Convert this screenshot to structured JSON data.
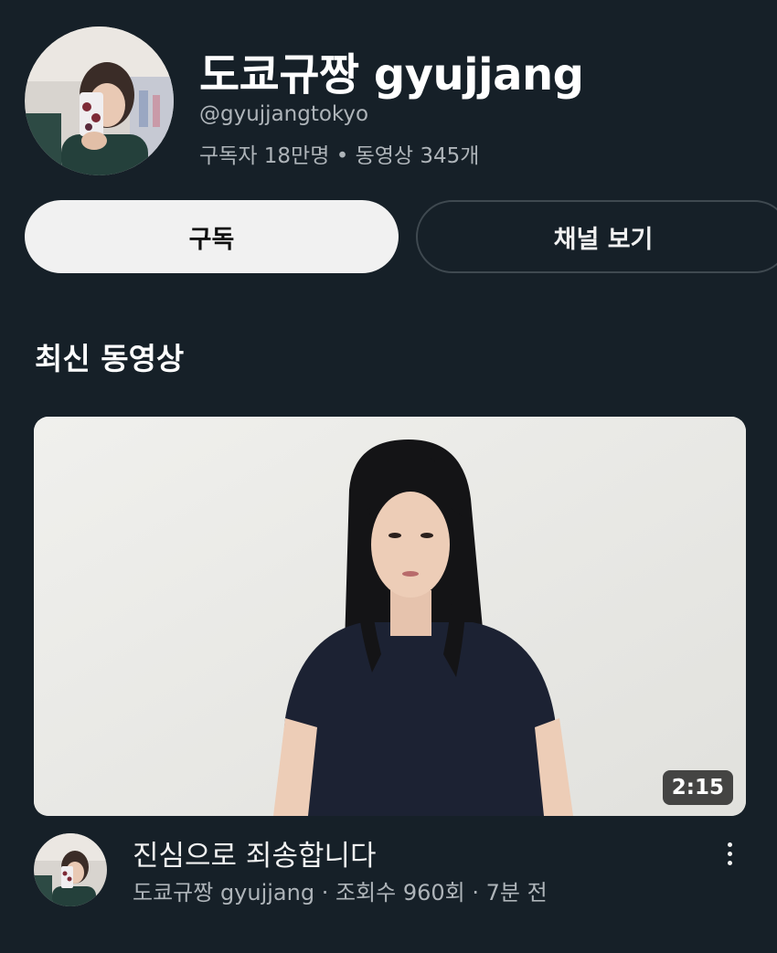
{
  "channel": {
    "name": "도쿄규짱 gyujjang",
    "handle": "@gyujjangtokyo",
    "stats": "구독자 18만명 • 동영상 345개"
  },
  "actions": {
    "subscribe_label": "구독",
    "view_channel_label": "채널 보기"
  },
  "section": {
    "title": "최신 동영상"
  },
  "video": {
    "duration": "2:15",
    "title": "진심으로 죄송합니다",
    "meta": "도쿄규짱 gyujjang · 조회수 960회 · 7분 전"
  },
  "icons": {
    "more": "more-vert-icon"
  },
  "colors": {
    "background": "#162028",
    "subscribe_button": "#f1f1f1",
    "secondary_text": "#aeb4b9"
  }
}
